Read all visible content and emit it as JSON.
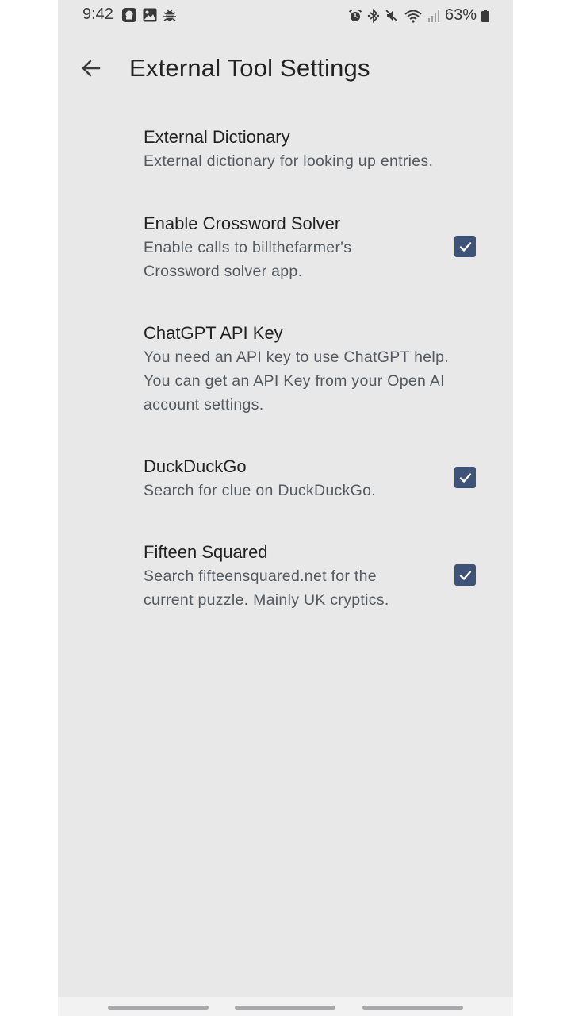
{
  "status_bar": {
    "time": "9:42",
    "battery": "63%",
    "left_icons": [
      "messenger-icon",
      "image-icon",
      "bug-icon"
    ],
    "right_icons": [
      "alarm-icon",
      "bluetooth-icon",
      "mute-icon",
      "wifi-icon",
      "signal-icon",
      "battery-icon"
    ]
  },
  "toolbar": {
    "title": "External Tool Settings",
    "back_icon": "arrow-back-icon"
  },
  "preferences": [
    {
      "title": "External Dictionary",
      "summary": "External dictionary for looking up entries.",
      "has_checkbox": false
    },
    {
      "title": "Enable Crossword Solver",
      "summary": "Enable calls to billthefarmer's Crossword solver app.",
      "has_checkbox": true,
      "checked": true
    },
    {
      "title": "ChatGPT API Key",
      "summary": "You need an API key to use ChatGPT help. You can get an API Key from your Open AI account settings.",
      "has_checkbox": false
    },
    {
      "title": "DuckDuckGo",
      "summary": "Search for clue on DuckDuckGo.",
      "has_checkbox": true,
      "checked": true
    },
    {
      "title": "Fifteen Squared",
      "summary": "Search fifteensquared.net for the current puzzle. Mainly UK cryptics.",
      "has_checkbox": true,
      "checked": true
    }
  ],
  "colors": {
    "background": "#e8e8e9",
    "checkbox": "#3f5378",
    "title_text": "#222222",
    "summary_text": "#555a5e"
  }
}
